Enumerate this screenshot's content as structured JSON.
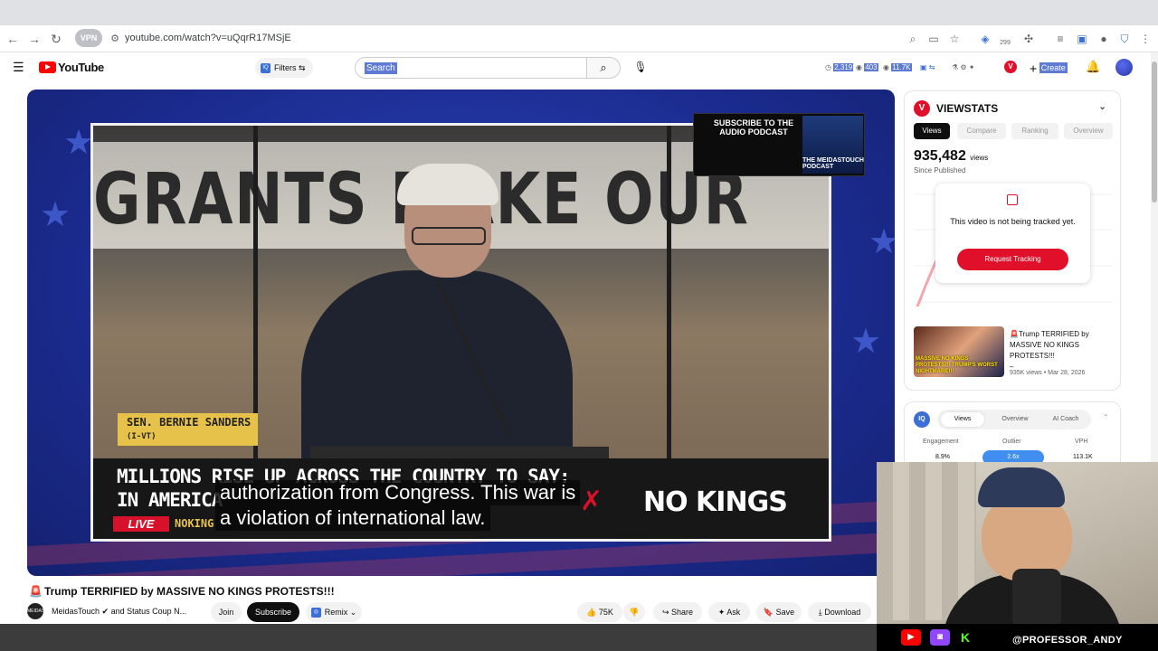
{
  "browser": {
    "vpn_label": "VPN",
    "url": "youtube.com/watch?v=uQqrR17MSjE",
    "ext_badge": "299"
  },
  "header": {
    "logo_text": "YouTube",
    "filters_label": "Filters",
    "filters_badge": "IQ",
    "search_placeholder": "Search",
    "stats": [
      "2,319",
      "403",
      "11.7K"
    ],
    "create_label": "Create",
    "v_badge": "V"
  },
  "player": {
    "banner_text": "GRANTS MAKE OUR",
    "nameplate_name": "SEN. BERNIE SANDERS",
    "nameplate_state": "(I-VT)",
    "lower_line1": "MILLIONS RISE UP ACROSS THE COUNTRY TO SAY:",
    "lower_line2": "IN AMERICA",
    "live_label": "LIVE",
    "ticker": "NOKING",
    "logo_text": "NO KINGS",
    "captions": [
      "authorization from Congress. This war is",
      "a violation of international law."
    ],
    "podcast_promo": "SUBSCRIBE TO THE AUDIO PODCAST",
    "podcast_brand": "THE MEIDASTOUCH PODCAST"
  },
  "video": {
    "title": "Trump TERRIFIED by MASSIVE NO KINGS PROTESTS!!!",
    "channel": "MeidasTouch ✔ and Status Coup N...",
    "channel_avatar": "MEIDAS",
    "join_label": "Join",
    "subscribe_label": "Subscribe",
    "remix_label": "Remix",
    "likes": "75K",
    "share_label": "Share",
    "ask_label": "Ask",
    "save_label": "Save",
    "download_label": "Download"
  },
  "viewstats": {
    "logo": "V",
    "title": "VIEWSTATS",
    "tabs": [
      "Views",
      "Compare",
      "Ranking",
      "Overview"
    ],
    "views": "935,482",
    "views_unit": "views",
    "since": "Since Published",
    "not_tracked": "This video is not being tracked yet.",
    "button": "Request Tracking",
    "related_title": "Trump TERRIFIED by MASSIVE NO KINGS PROTESTS!!!",
    "related_dash": "–",
    "related_meta": "935K views • Mar 28, 2026",
    "thumb_text": "MASSIVE NO KINGS PROTESTS!!! TRUMP'S WORST NIGHTMARE!!!"
  },
  "iq": {
    "logo": "IQ",
    "tabs": [
      "Views",
      "Overview",
      "AI Coach"
    ],
    "labels": [
      "Engagement",
      "Outlier",
      "VPH"
    ],
    "values": [
      "8.9%",
      "2.6x",
      "113.1K"
    ]
  },
  "webcam": {
    "handle": "@PROFESSOR_ANDY",
    "icons": [
      "youtube-icon",
      "twitch-icon",
      "kick-icon"
    ]
  },
  "colors": {
    "yt_red": "#ff0000",
    "accent_red": "#e0102b",
    "selection_blue": "#5d7bd5",
    "player_blue": "#1b2b8f"
  }
}
